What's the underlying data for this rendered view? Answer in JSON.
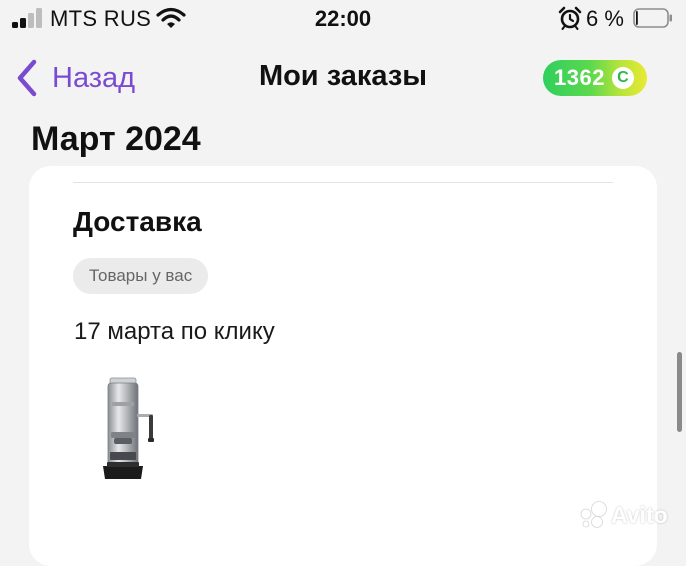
{
  "status_bar": {
    "carrier": "MTS RUS",
    "time": "22:00",
    "battery_percent": "6 %",
    "battery_level": 0.06,
    "icons": [
      "signal-icon",
      "wifi-icon",
      "alarm-icon",
      "battery-icon"
    ]
  },
  "nav": {
    "back_label": "Назад",
    "title": "Мои заказы",
    "bonus_value": "1362",
    "bonus_symbol": "С",
    "accent_color": "#7a4bd1"
  },
  "section": {
    "month": "Март 2024"
  },
  "order": {
    "type": "Доставка",
    "status_badge": "Товары у вас",
    "date_text": "17 марта по клику",
    "product_icon": "coffee-machine-image"
  },
  "watermark": {
    "brand": "Avito"
  }
}
